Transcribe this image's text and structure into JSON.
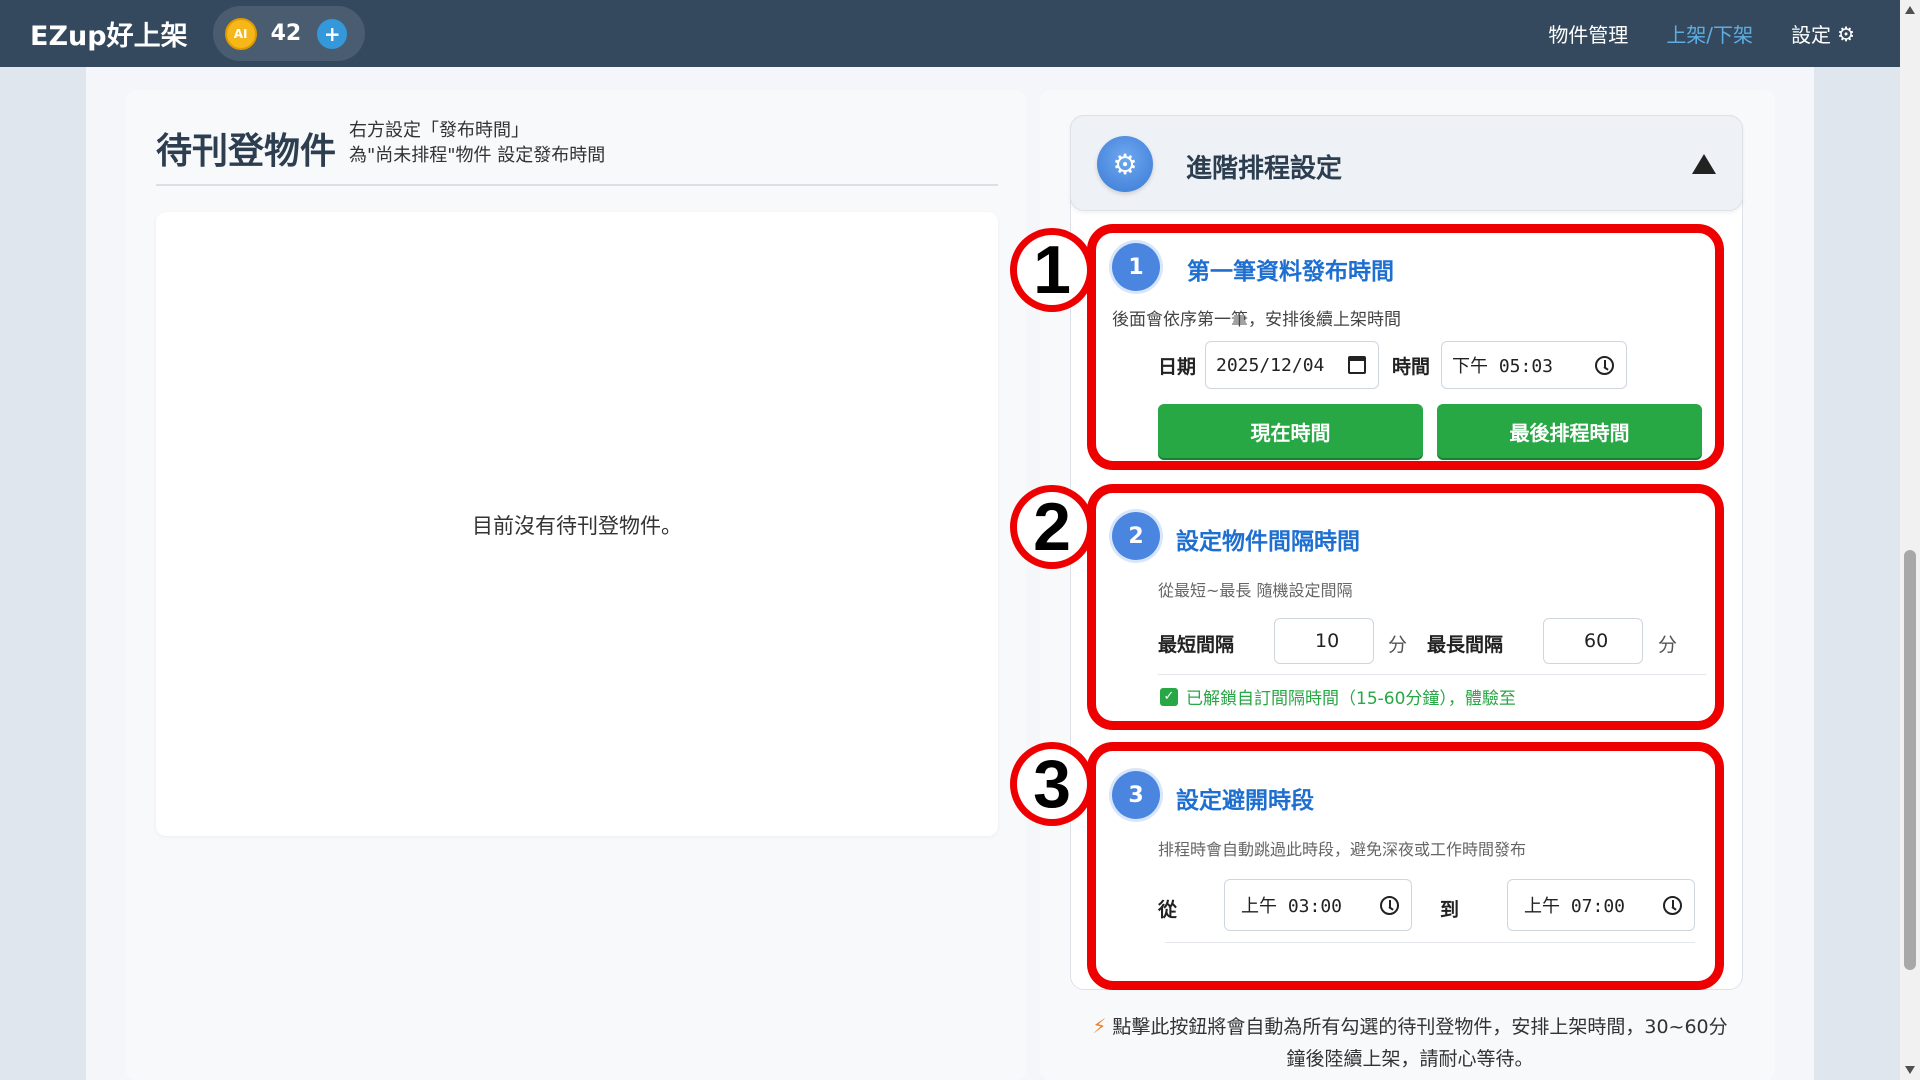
{
  "navbar": {
    "brand": "EZup好上架",
    "ai_badge": "AI",
    "credits": "42",
    "plus": "+",
    "links": [
      "物件管理",
      "上架/下架",
      "設定"
    ]
  },
  "left": {
    "title": "待刊登物件",
    "hint_line1": "右方設定「發布時間」",
    "hint_line2": "為\"尚未排程\"物件 設定發布時間",
    "empty_message": "目前沒有待刊登物件。"
  },
  "advanced": {
    "title": "進階排程設定",
    "step1": {
      "number": "1",
      "title": "第一筆資料發布時間",
      "desc": "後面會依序第一筆，安排後續上架時間",
      "date_label": "日期",
      "date_value": "2025/12/04",
      "time_label": "時間",
      "time_value": "下午 05:03",
      "now_button": "現在時間",
      "last_button": "最後排程時間"
    },
    "step2": {
      "number": "2",
      "title": "設定物件間隔時間",
      "desc": "從最短~最長 隨機設定間隔",
      "min_label": "最短間隔",
      "min_value": "10",
      "max_label": "最長間隔",
      "max_value": "60",
      "unit": "分",
      "unlock_note": "已解鎖自訂間隔時間（15-60分鐘），體驗至"
    },
    "step3": {
      "number": "3",
      "title": "設定避開時段",
      "desc": "排程時會自動跳過此時段，避免深夜或工作時間發布",
      "from_label": "從",
      "from_value": "上午 03:00",
      "to_label": "到",
      "to_value": "上午 07:00"
    }
  },
  "annotations": [
    "1",
    "2",
    "3"
  ],
  "footer": {
    "line1": "點擊此按鈕將會自動為所有勾選的待刊登物件，安排上架時間，30~60分",
    "line2": "鐘後陸續上架，請耐心等待。"
  },
  "colors": {
    "navbar": "#34495e",
    "accent_blue": "#1e6fd0",
    "green": "#28a745",
    "annotation_red": "#ee0000"
  }
}
